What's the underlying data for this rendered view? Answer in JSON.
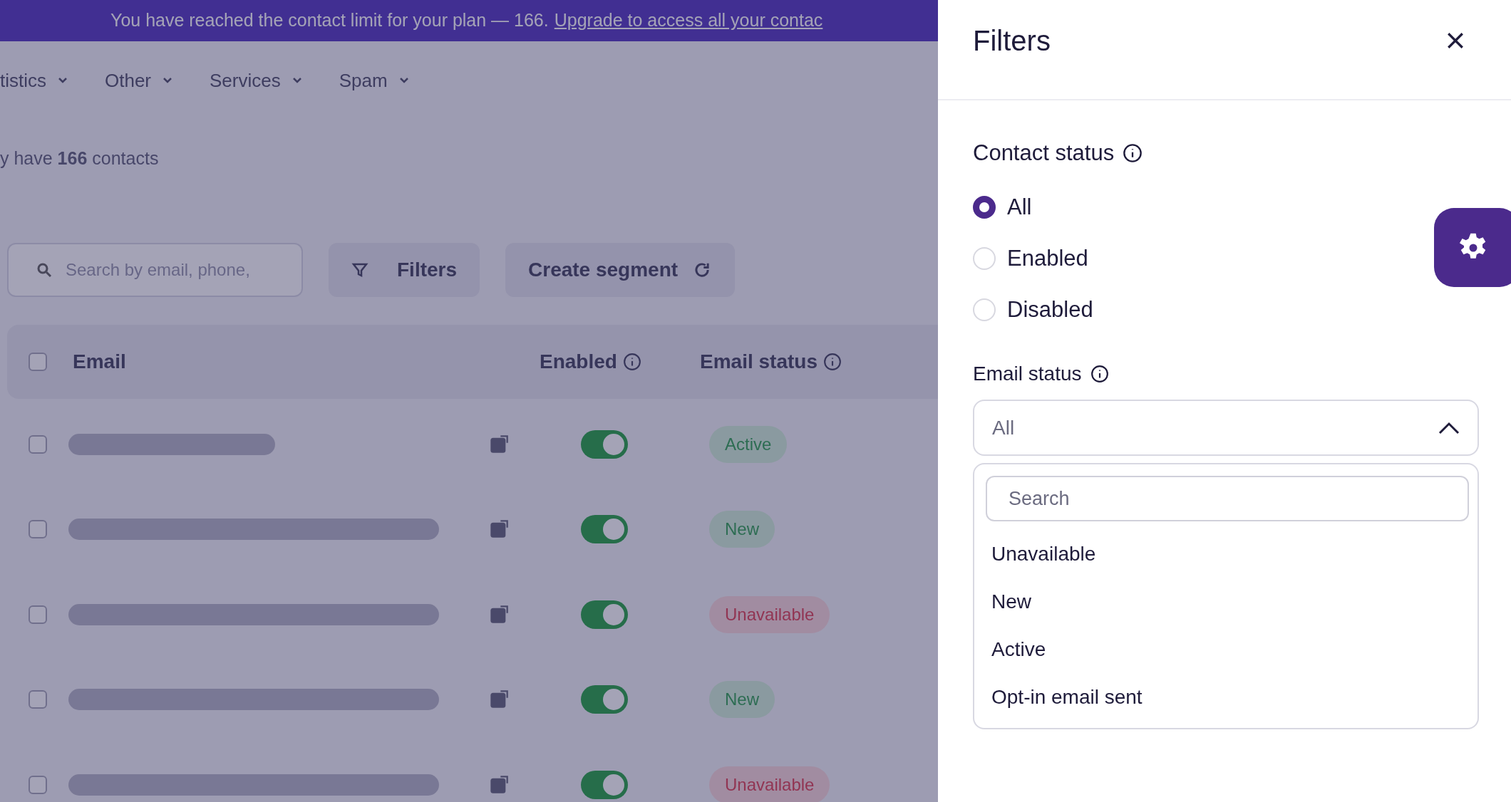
{
  "banner": {
    "text": "You have reached the contact limit for your plan — 166.",
    "link": "Upgrade to access all your contac"
  },
  "nav": [
    {
      "label": "tistics"
    },
    {
      "label": "Other"
    },
    {
      "label": "Services"
    },
    {
      "label": "Spam"
    }
  ],
  "summary": "y have **166** contacts",
  "toolbar": {
    "search_placeholder": "Search by email, phone,",
    "filters_button": "Filters",
    "segment_button": "Create segment"
  },
  "table": {
    "columns": [
      "Email",
      "Enabled",
      "Email status"
    ],
    "select_all_checked": false,
    "rows": [
      {
        "checked": false,
        "enabled": true,
        "status": "Active",
        "kind": "good"
      },
      {
        "checked": false,
        "enabled": true,
        "status": "New",
        "kind": "good"
      },
      {
        "checked": false,
        "enabled": true,
        "status": "Unavailable",
        "kind": "bad"
      },
      {
        "checked": false,
        "enabled": true,
        "status": "New",
        "kind": "good"
      },
      {
        "checked": false,
        "enabled": true,
        "status": "Unavailable",
        "kind": "bad"
      }
    ]
  },
  "filters_panel": {
    "title": "Filters",
    "contact_status": {
      "label": "Contact status",
      "options": [
        {
          "label": "All",
          "selected": true
        },
        {
          "label": "Enabled",
          "selected": false
        },
        {
          "label": "Disabled",
          "selected": false
        }
      ]
    },
    "email_status": {
      "label": "Email status",
      "value": "All",
      "expanded": true,
      "search_placeholder": "Search",
      "options": [
        "Unavailable",
        "New",
        "Active",
        "Opt-in email sent"
      ]
    }
  }
}
